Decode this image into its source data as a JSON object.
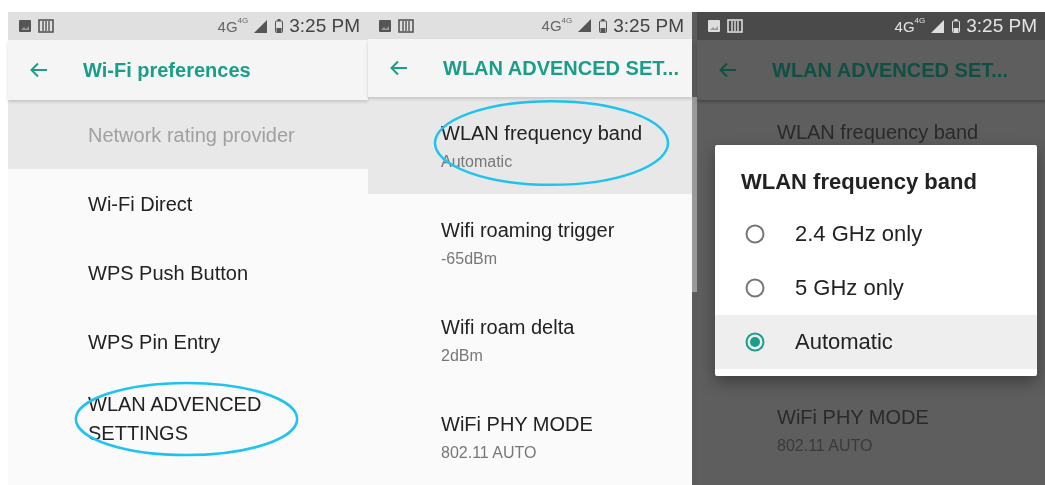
{
  "panels": [
    {
      "kind": "list",
      "status_bar": {
        "network": "4G",
        "network_badge": "4G",
        "time": "3:25 PM"
      },
      "title": "Wi-Fi preferences",
      "rows": [
        {
          "title": "Network rating provider",
          "disabled": true,
          "highlighted": true,
          "circled": false
        },
        {
          "title": "Wi-Fi Direct",
          "disabled": false,
          "highlighted": false,
          "circled": false
        },
        {
          "title": "WPS Push Button",
          "disabled": false,
          "highlighted": false,
          "circled": false
        },
        {
          "title": "WPS Pin Entry",
          "disabled": false,
          "highlighted": false,
          "circled": false
        },
        {
          "title": "WLAN ADVENCED SETTINGS",
          "disabled": false,
          "highlighted": false,
          "circled": true
        }
      ]
    },
    {
      "kind": "list",
      "status_bar": {
        "network": "4G",
        "network_badge": "4G",
        "time": "3:25 PM"
      },
      "title": "WLAN ADVENCED SET...",
      "scrollbar": true,
      "rows": [
        {
          "title": "WLAN frequency band",
          "summary": "Automatic",
          "disabled": false,
          "highlighted": true,
          "circled": true
        },
        {
          "title": "Wifi roaming trigger",
          "summary": "-65dBm",
          "disabled": false,
          "highlighted": false,
          "circled": false
        },
        {
          "title": "Wifi roam delta",
          "summary": "2dBm",
          "disabled": false,
          "highlighted": false,
          "circled": false
        },
        {
          "title": "WiFi PHY MODE",
          "summary": "802.11 AUTO",
          "disabled": false,
          "highlighted": false,
          "circled": false
        }
      ]
    },
    {
      "kind": "dialog",
      "status_bar": {
        "network": "4G",
        "network_badge": "4G",
        "time": "3:25 PM"
      },
      "title": "WLAN ADVENCED SET...",
      "rows": [
        {
          "title": "WLAN frequency band"
        },
        {
          "title": "WiFi PHY MODE",
          "summary": "802.11 AUTO"
        }
      ],
      "dialog": {
        "title": "WLAN frequency band",
        "options": [
          {
            "label": "2.4 GHz only",
            "selected": false
          },
          {
            "label": "5 GHz only",
            "selected": false
          },
          {
            "label": "Automatic",
            "selected": true
          }
        ]
      }
    }
  ]
}
